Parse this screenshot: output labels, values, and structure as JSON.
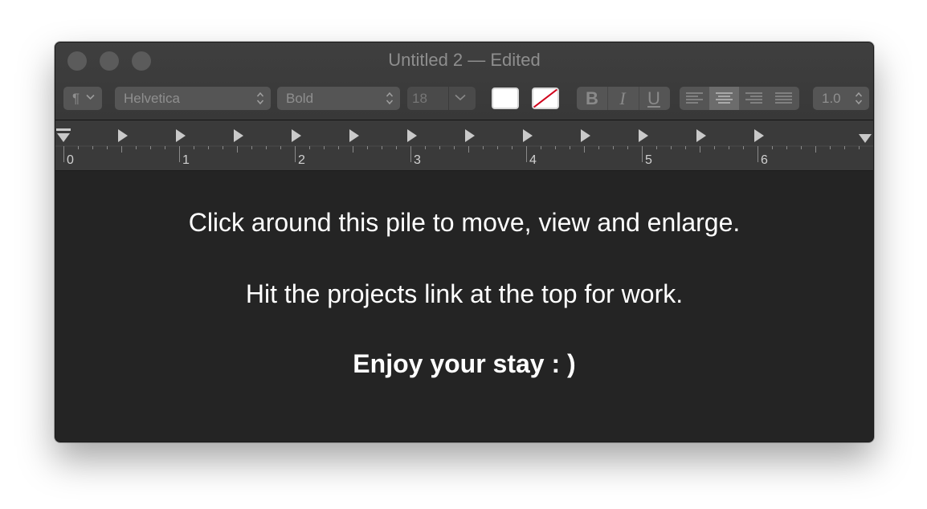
{
  "window": {
    "title": "Untitled 2 — Edited"
  },
  "toolbar": {
    "paragraph_icon": "pilcrow-icon",
    "paragraph_glyph": "¶",
    "font_family": "Helvetica",
    "font_style": "Bold",
    "font_size": "18",
    "text_color": "#ffffff",
    "background_color": "none",
    "bold_label": "B",
    "italic_label": "I",
    "underline_label": "U",
    "alignments": [
      "left",
      "center",
      "right",
      "justify"
    ],
    "selected_alignment": "center",
    "line_spacing": "1.0"
  },
  "ruler": {
    "labels": [
      "0",
      "1",
      "2",
      "3",
      "4",
      "5",
      "6"
    ]
  },
  "document": {
    "line1": "Click around this pile to move, view and enlarge.",
    "line2": "Hit the projects link at the top for work.",
    "line3": "Enjoy your stay : )"
  }
}
